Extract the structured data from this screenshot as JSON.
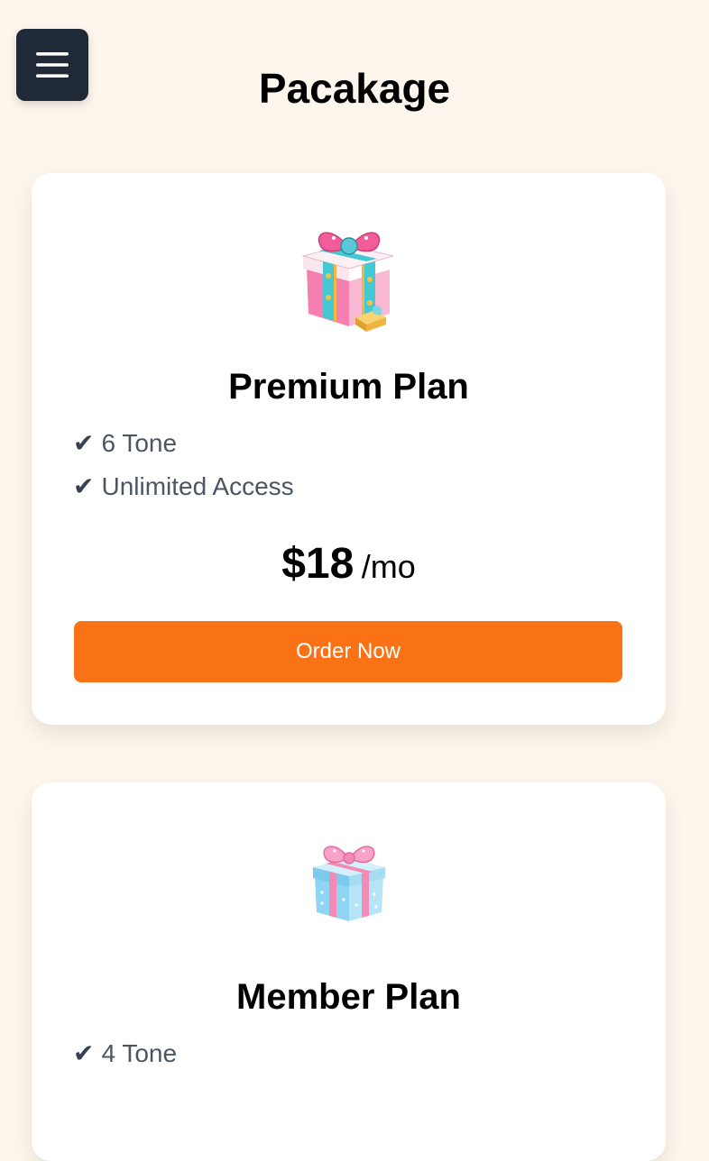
{
  "header": {
    "title": "Pacakage",
    "menu_icon": "hamburger-menu-icon"
  },
  "colors": {
    "background": "#fdf6ec",
    "menu_button": "#1f2937",
    "accent": "#f97316",
    "feature_text": "#4b5563"
  },
  "plans": [
    {
      "icon": "gift-box-icon",
      "name": "Premium Plan",
      "features": [
        "6 Tone",
        "Unlimited Access"
      ],
      "price": "$18",
      "period": "/mo",
      "button_label": "Order Now"
    },
    {
      "icon": "gift-box-icon",
      "name": "Member Plan",
      "features": [
        "4 Tone"
      ]
    }
  ],
  "check_glyph": "✔"
}
